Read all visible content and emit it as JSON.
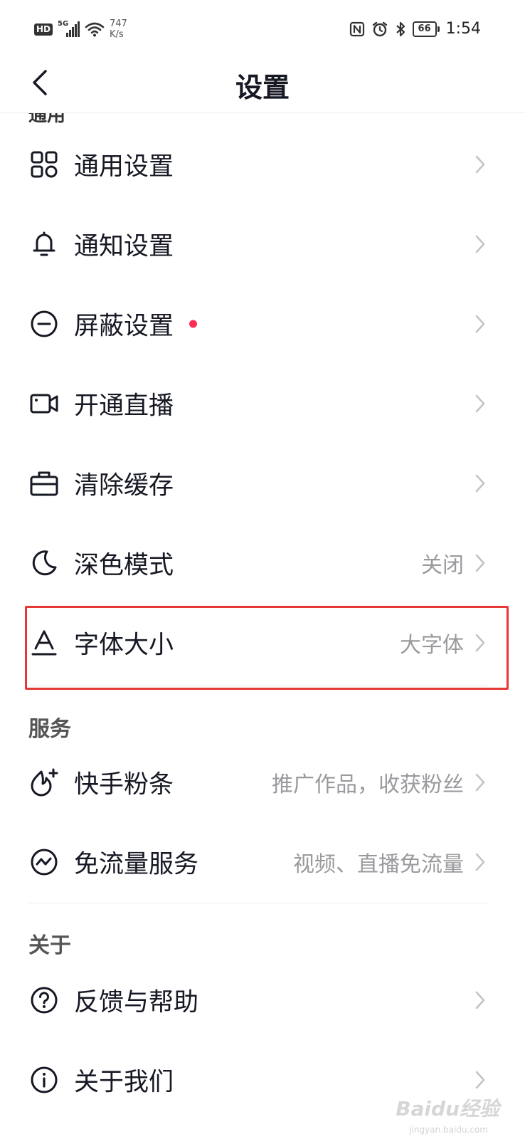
{
  "status_bar": {
    "hd": "HD",
    "network": "5G",
    "speed_value": "747",
    "speed_unit": "K/s",
    "battery": "66",
    "time": "1:54"
  },
  "header": {
    "title": "设置"
  },
  "sections": {
    "general_cut": "通用",
    "service": "服务",
    "about": "关于"
  },
  "rows": {
    "general_settings": {
      "label": "通用设置",
      "icon": "grid-icon"
    },
    "notification_settings": {
      "label": "通知设置",
      "icon": "bell-icon"
    },
    "block_settings": {
      "label": "屏蔽设置",
      "icon": "minus-circle-icon"
    },
    "open_live": {
      "label": "开通直播",
      "icon": "video-camera-icon"
    },
    "clear_cache": {
      "label": "清除缓存",
      "icon": "briefcase-icon"
    },
    "dark_mode": {
      "label": "深色模式",
      "value": "关闭",
      "icon": "moon-icon"
    },
    "font_size": {
      "label": "字体大小",
      "value": "大字体",
      "icon": "font-a-icon"
    },
    "kuaishou_fans": {
      "label": "快手粉条",
      "value": "推广作品，收获粉丝",
      "icon": "flame-plus-icon"
    },
    "free_data": {
      "label": "免流量服务",
      "value": "视频、直播免流量",
      "icon": "wave-circle-icon"
    },
    "feedback_help": {
      "label": "反馈与帮助",
      "icon": "question-circle-icon"
    },
    "about_us": {
      "label": "关于我们",
      "icon": "info-circle-icon"
    }
  },
  "colors": {
    "text": "#161823",
    "secondary": "#9a9a9e",
    "accent_dot": "#fe2c55",
    "highlight": "#e53935"
  },
  "watermark": {
    "text": "Baidu经验",
    "sub": "jingyan.baidu.com"
  }
}
